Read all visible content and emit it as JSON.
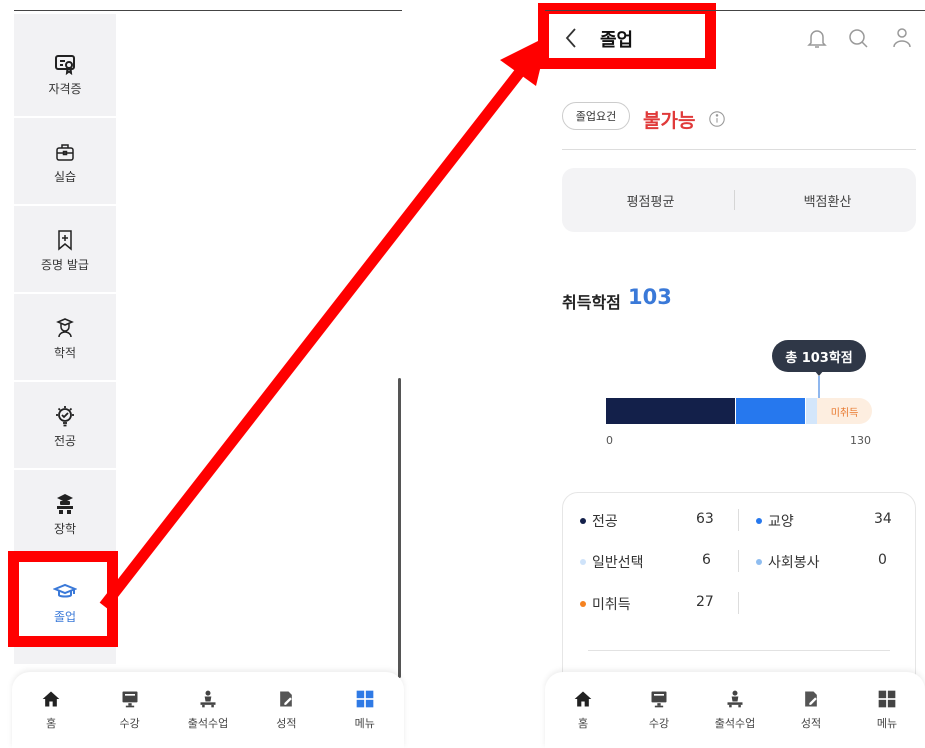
{
  "left_screen": {
    "sidebar": {
      "items": [
        {
          "label": "자격증",
          "icon": "certificate-icon"
        },
        {
          "label": "실습",
          "icon": "briefcase-icon"
        },
        {
          "label": "증명 발급",
          "icon": "bookmark-plus-icon"
        },
        {
          "label": "학적",
          "icon": "student-icon"
        },
        {
          "label": "전공",
          "icon": "lightbulb-gear-icon"
        },
        {
          "label": "장학",
          "icon": "scholarship-icon"
        },
        {
          "label": "졸업",
          "icon": "graduation-cap-icon",
          "active": true
        }
      ]
    },
    "bottom_nav": [
      {
        "label": "홈",
        "icon": "home-icon"
      },
      {
        "label": "수강",
        "icon": "monitor-icon"
      },
      {
        "label": "출석수업",
        "icon": "lecture-icon"
      },
      {
        "label": "성적",
        "icon": "grade-icon"
      },
      {
        "label": "메뉴",
        "icon": "menu-grid-icon",
        "active": true
      }
    ]
  },
  "right_screen": {
    "header": {
      "title": "졸업"
    },
    "graduation_requirement": {
      "chip": "졸업요건",
      "status": "불가능"
    },
    "tabs": [
      "평점평균",
      "백점환산"
    ],
    "credits": {
      "label": "취득학점",
      "value": "103"
    },
    "progress": {
      "tooltip": "총 103학점",
      "min_label": "0",
      "max_label": "130",
      "total": 130,
      "segments": [
        {
          "name": "전공",
          "value": 63,
          "color": "#13204a"
        },
        {
          "name": "교양",
          "value": 34,
          "color": "#2678ee"
        },
        {
          "name": "일반선택",
          "value": 6,
          "color": "#d3e6fb"
        },
        {
          "name": "미취득",
          "value": 27,
          "color": "#fdeee0",
          "label": "미취득"
        }
      ]
    },
    "legend": [
      {
        "name": "전공",
        "value": "63",
        "color": "#13204a"
      },
      {
        "name": "교양",
        "value": "34",
        "color": "#2678ee"
      },
      {
        "name": "일반선택",
        "value": "6",
        "color": "#cfe3fa"
      },
      {
        "name": "사회봉사",
        "value": "0",
        "color": "#8fbdf0"
      },
      {
        "name": "미취득",
        "value": "27",
        "color": "#f58220"
      }
    ],
    "bottom_nav": [
      {
        "label": "홈"
      },
      {
        "label": "수강"
      },
      {
        "label": "출석수업"
      },
      {
        "label": "성적"
      },
      {
        "label": "메뉴"
      }
    ]
  },
  "colors": {
    "accent": "#3a79d8",
    "highlight": "#ff0000",
    "error": "#e03a3a"
  }
}
